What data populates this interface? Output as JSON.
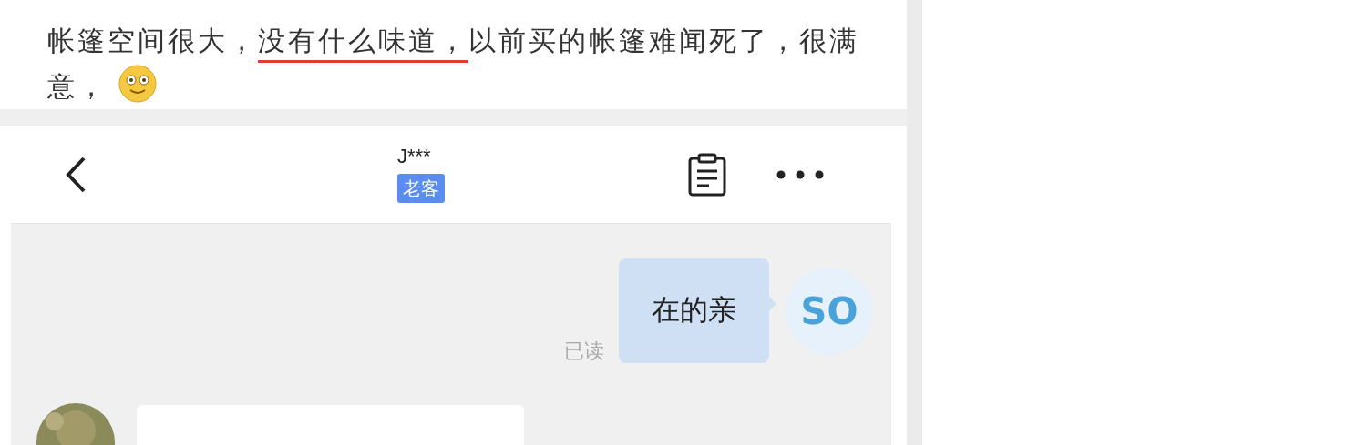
{
  "review": {
    "text_before": "帐篷空间很大，",
    "highlighted": "没有什么味道，",
    "text_after": "以前买的帐篷难闻死了，很满意，"
  },
  "chat": {
    "header": {
      "name": "J***",
      "badge": "老客"
    },
    "messages": [
      {
        "kind": "outgoing",
        "text": "在的亲",
        "status": "已读",
        "avatar": "SO"
      },
      {
        "kind": "incoming"
      }
    ]
  }
}
